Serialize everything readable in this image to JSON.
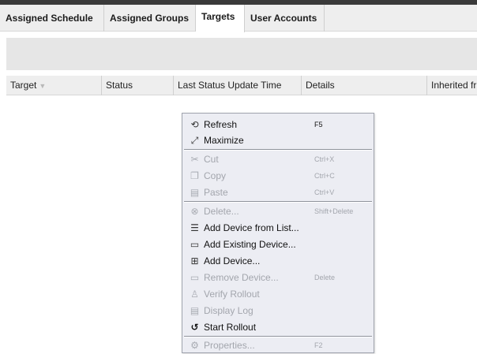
{
  "tabs": [
    {
      "label": "Assigned Schedule",
      "active": false
    },
    {
      "label": "Assigned Groups",
      "active": false
    },
    {
      "label": "Targets",
      "active": true
    },
    {
      "label": "User Accounts",
      "active": false
    }
  ],
  "grid": {
    "columns": [
      "Target",
      "Status",
      "Last Status Update Time",
      "Details",
      "Inherited fr"
    ],
    "sort_icon": "sort-down-triangle-icon"
  },
  "context_menu": {
    "items": [
      {
        "label": "Refresh",
        "shortcut": "F5",
        "enabled": true,
        "icon": "refresh-icon"
      },
      {
        "label": "Maximize",
        "shortcut": "",
        "enabled": true,
        "icon": "maximize-icon"
      },
      {
        "label": "Cut",
        "shortcut": "Ctrl+X",
        "enabled": false,
        "icon": "cut-icon"
      },
      {
        "label": "Copy",
        "shortcut": "Ctrl+C",
        "enabled": false,
        "icon": "copy-icon"
      },
      {
        "label": "Paste",
        "shortcut": "Ctrl+V",
        "enabled": false,
        "icon": "paste-icon"
      },
      {
        "label": "Delete...",
        "shortcut": "Shift+Delete",
        "enabled": false,
        "icon": "delete-icon"
      },
      {
        "label": "Add Device from List...",
        "shortcut": "",
        "enabled": true,
        "icon": "add-device-from-list-icon"
      },
      {
        "label": "Add Existing Device...",
        "shortcut": "",
        "enabled": true,
        "icon": "add-existing-device-icon"
      },
      {
        "label": "Add Device...",
        "shortcut": "",
        "enabled": true,
        "icon": "add-device-icon"
      },
      {
        "label": "Remove Device...",
        "shortcut": "Delete",
        "enabled": false,
        "icon": "remove-device-icon"
      },
      {
        "label": "Verify Rollout",
        "shortcut": "",
        "enabled": false,
        "icon": "verify-rollout-icon"
      },
      {
        "label": "Display Log",
        "shortcut": "",
        "enabled": false,
        "icon": "display-log-icon"
      },
      {
        "label": "Start Rollout",
        "shortcut": "",
        "enabled": true,
        "icon": "start-rollout-icon"
      },
      {
        "label": "Properties...",
        "shortcut": "F2",
        "enabled": false,
        "icon": "properties-icon"
      }
    ]
  },
  "colors": {
    "menu_bg": "#ecedf3",
    "disabled_text": "#a3a6ad",
    "header_bg": "#eeeeee",
    "toolbar_bg": "#e6e6e6"
  }
}
